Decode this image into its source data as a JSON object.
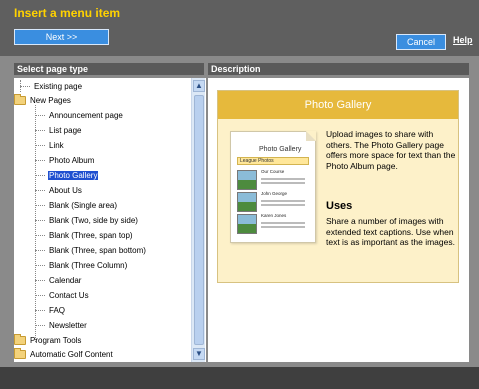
{
  "dialog": {
    "title": "Insert a menu item",
    "next_label": "Next >>",
    "cancel_label": "Cancel",
    "help_label": "Help"
  },
  "left_panel": {
    "heading": "Select page type"
  },
  "right_panel": {
    "heading": "Description"
  },
  "tree": {
    "items": [
      {
        "label": "Existing page"
      },
      {
        "label": "New Pages"
      },
      {
        "label": "Announcement page"
      },
      {
        "label": "List page"
      },
      {
        "label": "Link"
      },
      {
        "label": "Photo Album"
      },
      {
        "label": "Photo Gallery",
        "selected": true
      },
      {
        "label": "About Us"
      },
      {
        "label": "Blank (Single area)"
      },
      {
        "label": "Blank (Two, side by side)"
      },
      {
        "label": "Blank (Three, span top)"
      },
      {
        "label": "Blank (Three, span bottom)"
      },
      {
        "label": "Blank (Three Column)"
      },
      {
        "label": "Calendar"
      },
      {
        "label": "Contact Us"
      },
      {
        "label": "FAQ"
      },
      {
        "label": "Newsletter"
      },
      {
        "label": "Program Tools"
      },
      {
        "label": "Automatic Golf Content"
      }
    ]
  },
  "description": {
    "title": "Photo Gallery",
    "body": "Upload images to share with others. The Photo Gallery page offers more space for text than the Photo Album page.",
    "uses_heading": "Uses",
    "uses_body": "Share a number of images with extended text captions. Use when text is as important as  the images.",
    "thumbnail": {
      "title": "Photo Gallery",
      "subtitle": "League Photos",
      "captions": [
        "Our Course",
        "John George",
        "Karen Jones"
      ]
    }
  },
  "colors": {
    "accent_yellow": "#ffd200",
    "button_blue": "#3a8ee0",
    "selection": "#1f4fd0"
  }
}
